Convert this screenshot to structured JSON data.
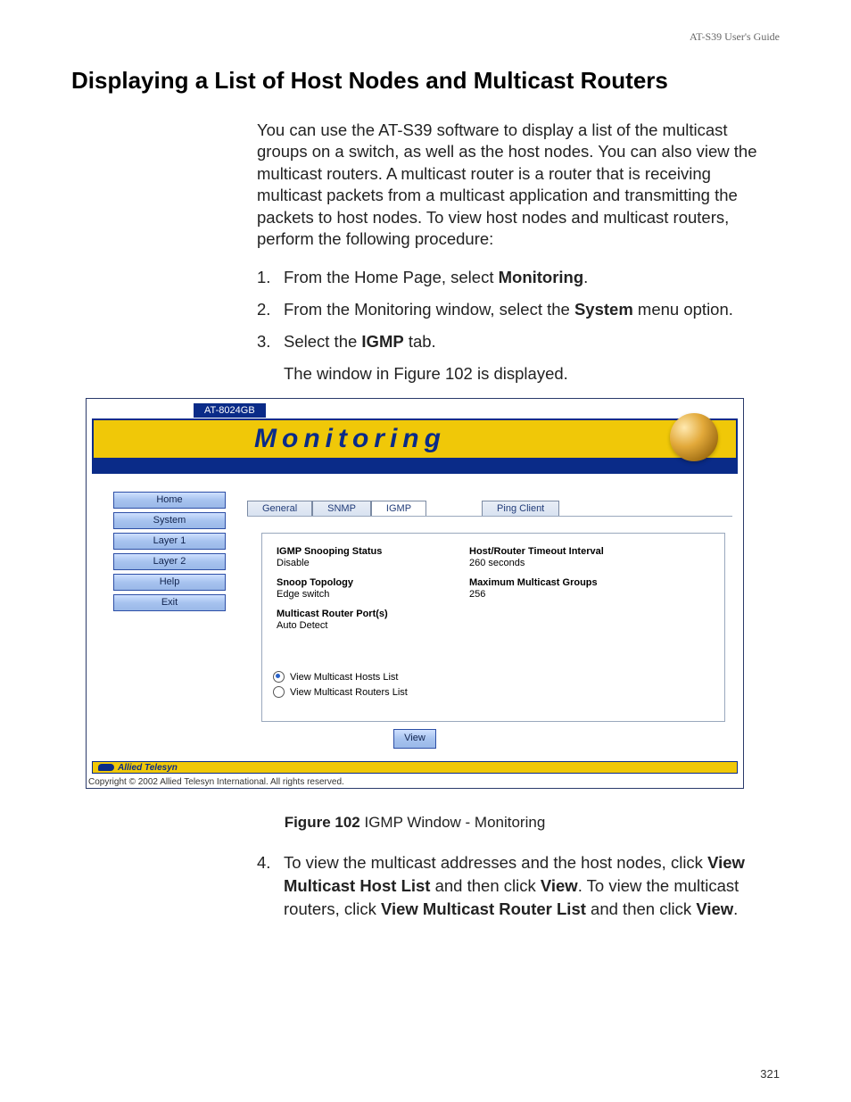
{
  "doc_header": "AT-S39 User's Guide",
  "section_title": "Displaying a List of Host Nodes and Multicast Routers",
  "intro": "You can use the AT-S39 software to display a list of the multicast groups on a switch, as well as the host nodes. You can also view the multicast routers. A multicast router is a router that is receiving multicast packets from a multicast application and transmitting the packets to host nodes. To view host nodes and multicast routers, perform the following procedure:",
  "steps": {
    "s1_pre": "From the Home Page, select ",
    "s1_b": "Monitoring",
    "s1_post": ".",
    "s2_pre": "From the Monitoring window, select the ",
    "s2_b": "System",
    "s2_post": " menu option.",
    "s3_pre": "Select the ",
    "s3_b": "IGMP",
    "s3_post": " tab.",
    "s3_sub": "The window in Figure 102 is displayed."
  },
  "figure": {
    "device_model": "AT-8024GB",
    "banner_title": "Monitoring",
    "nav": [
      "Home",
      "System",
      "Layer 1",
      "Layer 2",
      "Help",
      "Exit"
    ],
    "tabs_group1": [
      "General",
      "SNMP",
      "IGMP"
    ],
    "tabs_group2": [
      "Ping Client"
    ],
    "fields_left": [
      {
        "label": "IGMP Snooping Status",
        "value": "Disable"
      },
      {
        "label": "Snoop Topology",
        "value": "Edge switch"
      },
      {
        "label": "Multicast Router Port(s)",
        "value": "Auto Detect"
      }
    ],
    "fields_right": [
      {
        "label": "Host/Router Timeout Interval",
        "value": "260 seconds"
      },
      {
        "label": "Maximum Multicast Groups",
        "value": "256"
      }
    ],
    "radios": [
      {
        "label": "View Multicast Hosts List",
        "checked": true
      },
      {
        "label": "View Multicast Routers List",
        "checked": false
      }
    ],
    "view_button": "View",
    "footer_logo": "Allied Telesyn",
    "copyright": "Copyright © 2002 Allied Telesyn International. All rights reserved."
  },
  "figure_caption": {
    "bold": "Figure 102",
    "rest": "  IGMP Window - Monitoring"
  },
  "step4": {
    "t1": "To view the multicast addresses and the host nodes, click ",
    "b1": "View Multicast Host List",
    "t2": " and then click ",
    "b2": "View",
    "t3": ". To view the multicast routers, click ",
    "b3": "View Multicast Router List",
    "t4": " and then click ",
    "b4": "View",
    "t5": "."
  },
  "page_number": "321"
}
